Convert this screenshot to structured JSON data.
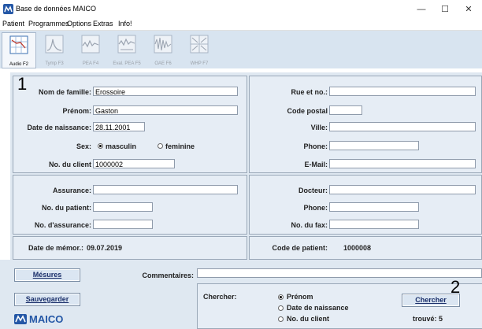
{
  "window": {
    "title": "Base de données MAICO",
    "minimize": "—",
    "maximize": "☐",
    "close": "✕"
  },
  "menu": [
    "Patient",
    "Programmes",
    "Options",
    "Extras",
    "Info!"
  ],
  "toolbar": [
    {
      "label": "Audio F2",
      "icon": "audiogram-icon",
      "active": true
    },
    {
      "label": "Tymp F3",
      "icon": "tymp-icon",
      "active": false
    },
    {
      "label": "PEA F4",
      "icon": "pea-icon",
      "active": false
    },
    {
      "label": "Eval. PEA F5",
      "icon": "eval-pea-icon",
      "active": false
    },
    {
      "label": "OAE F6",
      "icon": "oae-icon",
      "active": false
    },
    {
      "label": "WHP F7",
      "icon": "whp-icon",
      "active": false
    }
  ],
  "annotations": {
    "one": "1",
    "two": "2"
  },
  "patient": {
    "nom_label": "Nom de famille:",
    "nom": "Erossoire",
    "prenom_label": "Prénom:",
    "prenom": "Gaston",
    "naissance_label": "Date de naissance:",
    "naissance": "28.11.2001",
    "sex_label": "Sex:",
    "sex_m": "masculin",
    "sex_f": "feminine",
    "client_label": "No. du client",
    "client": "1000002"
  },
  "address": {
    "rue_label": "Rue et no.:",
    "rue": "",
    "cp_label": "Code postal",
    "cp": "",
    "ville_label": "Ville:",
    "ville": "",
    "phone_label": "Phone:",
    "phone": "",
    "email_label": "E-Mail:",
    "email": ""
  },
  "insurance": {
    "assurance_label": "Assurance:",
    "assurance": "",
    "no_patient_label": "No. du patient:",
    "no_patient": "",
    "no_assurance_label": "No. d'assurance:",
    "no_assurance": ""
  },
  "doctor": {
    "docteur_label": "Docteur:",
    "docteur": "",
    "phone_label": "Phone:",
    "phone": "",
    "fax_label": "No. du fax:",
    "fax": ""
  },
  "footer_info": {
    "memo_label": "Date de mémor.:",
    "memo": "09.07.2019",
    "code_label": "Code de patient:",
    "code": "1000008"
  },
  "bottom": {
    "mesures": "Mésures",
    "sauvegarder": "Sauvegarder",
    "commentaires_label": "Commentaires:",
    "commentaires": "",
    "chercher_label": "Chercher:",
    "opt1": "Prénom",
    "opt2": "Date de naissance",
    "opt3": "No. du client",
    "chercher_btn": "Chercher",
    "trouve": "trouvé:  5",
    "logo": "MAICO"
  },
  "colors": {
    "accent": "#1a2f6a",
    "panel": "#e6edf5",
    "toolbar": "#d8e4f0"
  }
}
